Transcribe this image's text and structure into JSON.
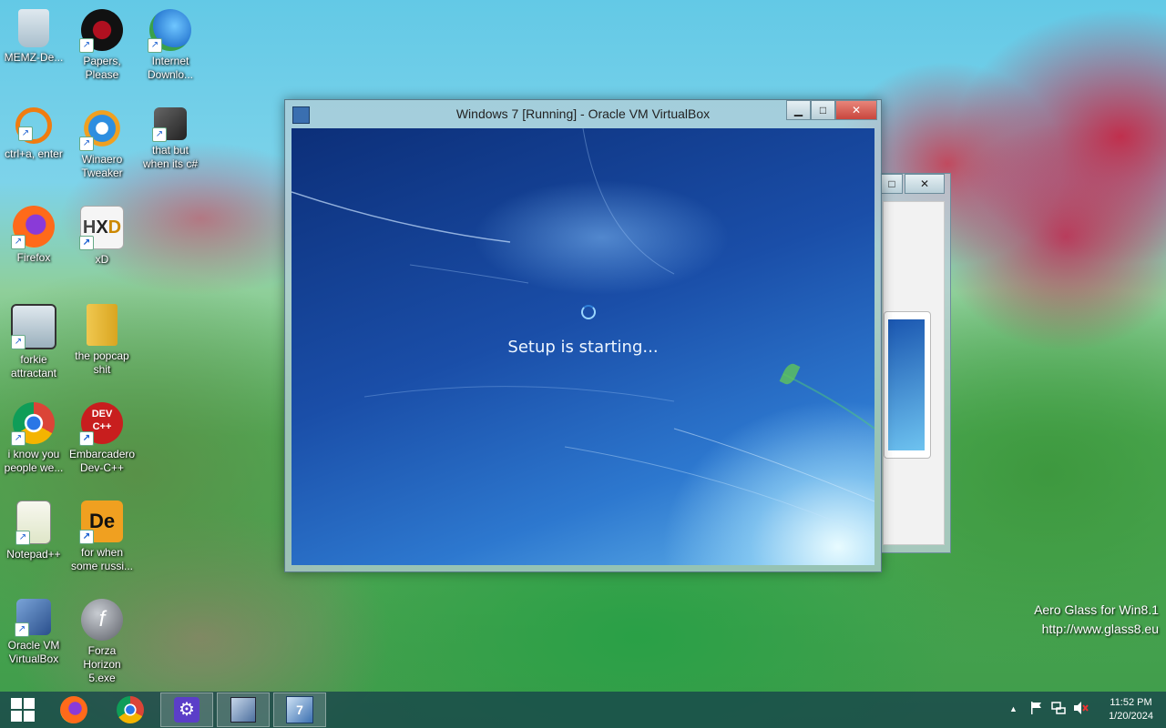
{
  "desktop": {
    "icons": [
      {
        "label": "MEMZ-De...",
        "icon": "recycle-bin-icon"
      },
      {
        "label": "Papers, Please",
        "icon": "papers-please-icon"
      },
      {
        "label": "Internet Downlo...",
        "icon": "internet-download-icon"
      },
      {
        "label": "ctrl+a, enter",
        "icon": "search-app-icon"
      },
      {
        "label": "Winaero Tweaker",
        "icon": "winaero-icon"
      },
      {
        "label": "that but when its c#",
        "icon": "stack-icon"
      },
      {
        "label": "Firefox",
        "icon": "firefox-icon"
      },
      {
        "label": "xD",
        "icon": "hxd-icon"
      },
      {
        "label": "forkie attractant",
        "icon": "gear-monitor-icon"
      },
      {
        "label": "the popcap shit",
        "icon": "folder-icon"
      },
      {
        "label": "i know you people we...",
        "icon": "chrome-icon"
      },
      {
        "label": "Embarcadero Dev-C++",
        "icon": "devcpp-icon"
      },
      {
        "label": "Notepad++",
        "icon": "notepadpp-icon"
      },
      {
        "label": "for when some russi...",
        "icon": "de-icon"
      },
      {
        "label": "Oracle VM VirtualBox",
        "icon": "virtualbox-icon"
      },
      {
        "label": "Forza Horizon 5.exe",
        "icon": "flash-icon"
      }
    ]
  },
  "vbox_window": {
    "title": "Windows 7 [Running] - Oracle VM VirtualBox",
    "minimize": "▁",
    "maximize": "□",
    "close": "✕",
    "setup_text": "Setup is starting..."
  },
  "bg_window": {
    "maximize": "□",
    "close": "✕"
  },
  "watermark": {
    "line1": "Aero Glass for Win8.1",
    "line2": "http://www.glass8.eu"
  },
  "taskbar": {
    "start": "start-icon",
    "pinned": [
      "firefox-icon",
      "chrome-icon",
      "settings-icon",
      "virtualbox-icon",
      "windows7-vm-icon"
    ],
    "tray": {
      "chevron": "▲",
      "flag": "flag-icon",
      "network": "network-icon",
      "volume": "volume-muted-icon"
    },
    "clock_time": "11:52 PM",
    "clock_date": "1/20/2024"
  },
  "colors": {
    "vm_background": "#1a4ea8",
    "taskbar": "#143c4b",
    "close_button": "#c9463d"
  }
}
